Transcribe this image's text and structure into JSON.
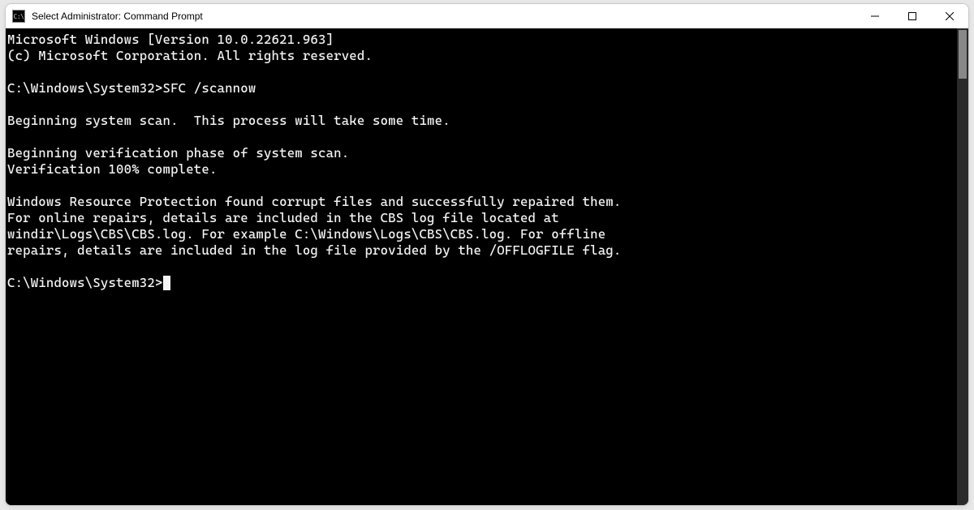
{
  "window": {
    "title": "Select Administrator: Command Prompt",
    "icon_label": "CMD"
  },
  "terminal": {
    "lines": [
      "Microsoft Windows [Version 10.0.22621.963]",
      "(c) Microsoft Corporation. All rights reserved.",
      "",
      "C:\\Windows\\System32>SFC /scannow",
      "",
      "Beginning system scan.  This process will take some time.",
      "",
      "Beginning verification phase of system scan.",
      "Verification 100% complete.",
      "",
      "Windows Resource Protection found corrupt files and successfully repaired them.",
      "For online repairs, details are included in the CBS log file located at",
      "windir\\Logs\\CBS\\CBS.log. For example C:\\Windows\\Logs\\CBS\\CBS.log. For offline",
      "repairs, details are included in the log file provided by the /OFFLOGFILE flag.",
      ""
    ],
    "prompt": "C:\\Windows\\System32>"
  }
}
